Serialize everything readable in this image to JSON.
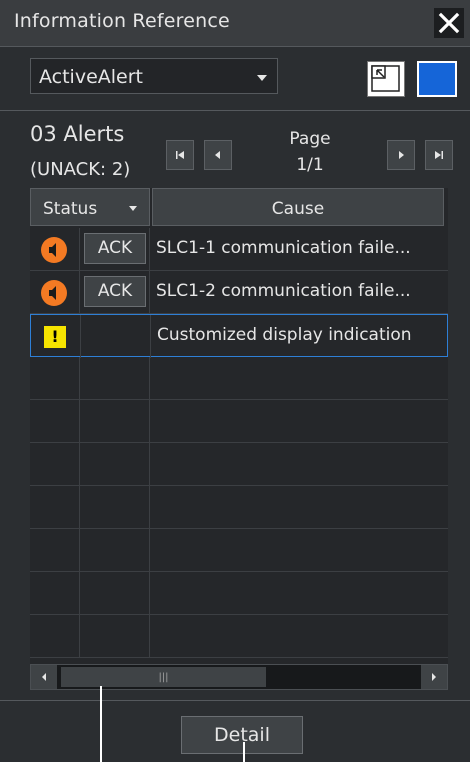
{
  "window": {
    "title": "Information Reference",
    "close_icon": "close-icon"
  },
  "filter": {
    "selected": "ActiveAlert",
    "options_icon": "chevron-down-icon"
  },
  "view_buttons": {
    "left_icon": "window-restore-icon",
    "right_icon": "window-maximize-icon",
    "right_color": "#1565d8"
  },
  "summary": {
    "count": "03 Alerts",
    "unack": "(UNACK: 2)"
  },
  "pager": {
    "label": "Page",
    "value": "1/1"
  },
  "table": {
    "columns": {
      "status": "Status",
      "cause": "Cause"
    },
    "rows": [
      {
        "icon": "alert-speaker-icon",
        "ack": "ACK",
        "cause": "SLC1-1 communication faile..."
      },
      {
        "icon": "alert-speaker-icon",
        "ack": "ACK",
        "cause": "SLC1-2 communication faile..."
      },
      {
        "icon": "caution-icon",
        "ack": "",
        "cause": "Customized display indication"
      }
    ],
    "empty_rows": 7,
    "selected_row": 2
  },
  "colors": {
    "alarm": "#f47a23",
    "caution": "#f6e400",
    "selection": "#2e7fd6"
  },
  "footer": {
    "detail_label": "Detail"
  }
}
